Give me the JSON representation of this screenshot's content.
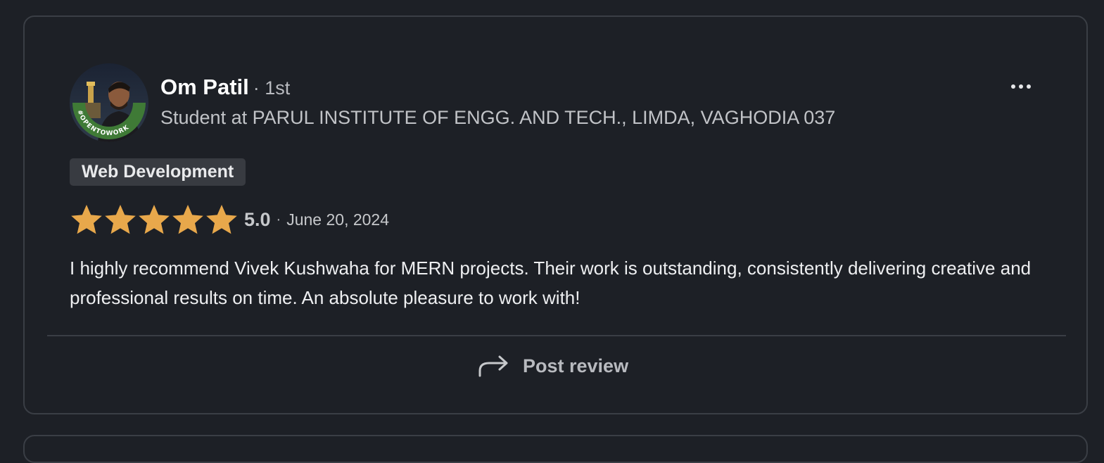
{
  "review": {
    "author": {
      "name": "Om Patil",
      "degree": "· 1st",
      "headline": "Student at PARUL INSTITUTE OF ENGG. AND TECH., LIMDA, VAGHODIA 037",
      "avatar_badge": "#OPENTOWORK"
    },
    "service_tag": "Web Development",
    "rating": {
      "stars": 5,
      "value": "5.0",
      "separator": "·",
      "date": "June 20, 2024"
    },
    "text": "I highly recommend Vivek Kushwaha for MERN projects. Their work is outstanding, consistently delivering creative and professional results on time. An absolute pleasure to work with!",
    "actions": {
      "post_label": "Post review",
      "post_icon": "share-arrow-icon",
      "more_icon": "more-horizontal-icon"
    }
  },
  "colors": {
    "background": "#1d2026",
    "star": "#e8a84b",
    "open_to_work": "#3f7a36",
    "border": "#3a3e45"
  }
}
